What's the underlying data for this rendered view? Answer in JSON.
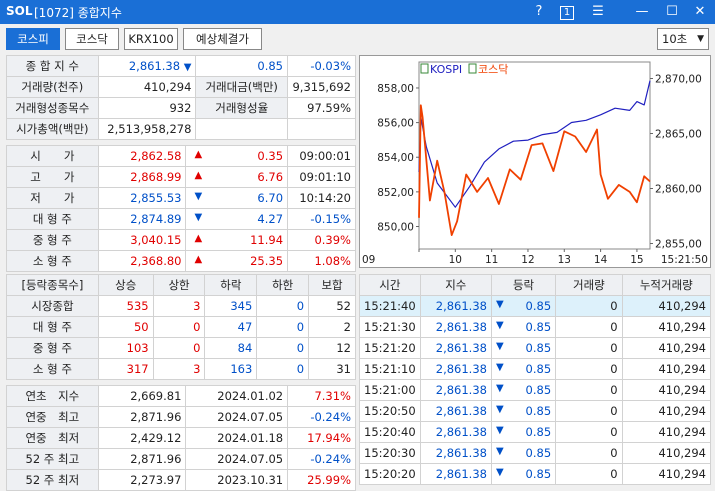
{
  "window": {
    "logo": "SOL",
    "title": "[1072] 종합지수",
    "help": "?",
    "badge": "1",
    "menu": "☰",
    "min": "—",
    "max": "☐",
    "close": "✕"
  },
  "tabs": [
    "코스피",
    "코스닥",
    "KRX100",
    "예상체결가"
  ],
  "interval": "10초",
  "summary": {
    "index_label": "종 합 지 수",
    "index_value": "2,861.38",
    "index_change": "0.85",
    "index_rate": "-0.03%",
    "volume_label": "거래량(천주)",
    "volume": "410,294",
    "amount_label": "거래대금(백만)",
    "amount": "9,315,692",
    "count_label": "거래형성종목수",
    "count": "932",
    "ratio_label": "거래형성율",
    "ratio": "97.59%",
    "cap_label": "시가총액(백만)",
    "cap": "2,513,958,278"
  },
  "prices": [
    {
      "label": "시　　가",
      "value": "2,862.58",
      "dir": "up",
      "change": "0.35",
      "extra": "09:00:01"
    },
    {
      "label": "고　　가",
      "value": "2,868.99",
      "dir": "up",
      "change": "6.76",
      "extra": "09:01:10"
    },
    {
      "label": "저　　가",
      "value": "2,855.53",
      "dir": "dn",
      "change": "6.70",
      "extra": "10:14:20"
    },
    {
      "label": "대 형 주",
      "value": "2,874.89",
      "dir": "dn",
      "change": "4.27",
      "extra": "-0.15%"
    },
    {
      "label": "중 형 주",
      "value": "3,040.15",
      "dir": "up",
      "change": "11.94",
      "extra": "0.39%"
    },
    {
      "label": "소 형 주",
      "value": "2,368.80",
      "dir": "up",
      "change": "25.35",
      "extra": "1.08%"
    }
  ],
  "breadth": {
    "headers": [
      "[등락종목수]",
      "상승",
      "상한",
      "하락",
      "하한",
      "보합"
    ],
    "rows": [
      [
        "시장종합",
        "535",
        "3",
        "345",
        "0",
        "52"
      ],
      [
        "대 형 주",
        "50",
        "0",
        "47",
        "0",
        "2"
      ],
      [
        "중 형 주",
        "103",
        "0",
        "84",
        "0",
        "12"
      ],
      [
        "소 형 주",
        "317",
        "3",
        "163",
        "0",
        "31"
      ]
    ]
  },
  "yearly": [
    {
      "label": "연초　지수",
      "value": "2,669.81",
      "date": "2024.01.02",
      "rate": "7.31%"
    },
    {
      "label": "연중　최고",
      "value": "2,871.96",
      "date": "2024.07.05",
      "rate": "-0.24%"
    },
    {
      "label": "연중　최저",
      "value": "2,429.12",
      "date": "2024.01.18",
      "rate": "17.94%"
    },
    {
      "label": "52 주 최고",
      "value": "2,871.96",
      "date": "2024.07.05",
      "rate": "-0.24%"
    },
    {
      "label": "52 주 최저",
      "value": "2,273.97",
      "date": "2023.10.31",
      "rate": "25.99%"
    }
  ],
  "ticks": {
    "headers": [
      "시간",
      "지수",
      "등락",
      "거래량",
      "누적거래량"
    ],
    "rows": [
      [
        "15:21:40",
        "2,861.38",
        "0.85",
        "0",
        "410,294"
      ],
      [
        "15:21:30",
        "2,861.38",
        "0.85",
        "0",
        "410,294"
      ],
      [
        "15:21:20",
        "2,861.38",
        "0.85",
        "0",
        "410,294"
      ],
      [
        "15:21:10",
        "2,861.38",
        "0.85",
        "0",
        "410,294"
      ],
      [
        "15:21:00",
        "2,861.38",
        "0.85",
        "0",
        "410,294"
      ],
      [
        "15:20:50",
        "2,861.38",
        "0.85",
        "0",
        "410,294"
      ],
      [
        "15:20:40",
        "2,861.38",
        "0.85",
        "0",
        "410,294"
      ],
      [
        "15:20:30",
        "2,861.38",
        "0.85",
        "0",
        "410,294"
      ],
      [
        "15:20:20",
        "2,861.38",
        "0.85",
        "0",
        "410,294"
      ]
    ]
  },
  "chart_data": {
    "type": "line",
    "legend": [
      "KOSPI",
      "코스닥"
    ],
    "x_ticks": [
      "09",
      "10",
      "11",
      "12",
      "13",
      "14",
      "15",
      "15:21:50"
    ],
    "left_ticks": [
      "858,00",
      "856,00",
      "854,00",
      "852,00",
      "850,00"
    ],
    "right_ticks": [
      "2,870,00",
      "2,865,00",
      "2,860,00",
      "2,855,00"
    ],
    "left_ylim": [
      848.7,
      859.5
    ],
    "right_ylim": [
      2854.5,
      2871.5
    ],
    "series": [
      {
        "name": "KOSPI",
        "axis": "right",
        "color": "#2020c0",
        "x": [
          9.0,
          9.05,
          9.2,
          9.5,
          10.0,
          10.4,
          10.8,
          11.2,
          11.6,
          12.0,
          12.4,
          12.8,
          13.2,
          13.6,
          14.0,
          14.4,
          14.8,
          15.0,
          15.2,
          15.36
        ],
        "y": [
          2861.5,
          2866.5,
          2863.8,
          2860.5,
          2858.3,
          2860.2,
          2862.4,
          2863.6,
          2864.3,
          2864.4,
          2864.9,
          2865.1,
          2866.0,
          2866.2,
          2866.7,
          2867.3,
          2867.1,
          2867.9,
          2867.6,
          2869.8
        ]
      },
      {
        "name": "코스닥",
        "axis": "left",
        "color": "#f04000",
        "x": [
          9.0,
          9.05,
          9.1,
          9.3,
          9.5,
          9.7,
          9.9,
          10.05,
          10.3,
          10.6,
          10.9,
          11.2,
          11.5,
          11.8,
          12.1,
          12.4,
          12.7,
          13.0,
          13.3,
          13.6,
          13.9,
          14.0,
          14.2,
          14.5,
          14.8,
          15.0,
          15.2,
          15.36
        ],
        "y": [
          850.5,
          857.0,
          856.3,
          851.5,
          853.8,
          852.0,
          849.5,
          850.3,
          853.0,
          852.0,
          852.8,
          851.3,
          853.3,
          852.7,
          854.7,
          854.8,
          853.2,
          855.5,
          855.2,
          854.3,
          855.6,
          853.0,
          851.6,
          852.4,
          852.0,
          851.4,
          852.9,
          852.6
        ]
      }
    ]
  }
}
